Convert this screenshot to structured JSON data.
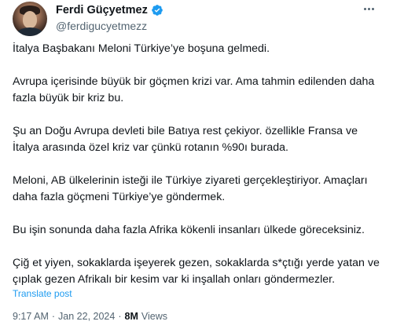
{
  "author": {
    "display_name": "Ferdi Güçyetmez",
    "handle": "@ferdigucyetmezz",
    "verified_icon": "verified-badge-icon",
    "verified_color": "#1d9bf0"
  },
  "more_icon": "more-options-icon",
  "tweet": {
    "paragraphs": [
      "İtalya Başbakanı Meloni Türkiye’ye boşuna gelmedi.",
      "Avrupa içerisinde büyük bir göçmen krizi var. Ama tahmin edilenden daha fazla büyük bir kriz bu.",
      "Şu an Doğu Avrupa devleti bile Batıya rest çekiyor. özellikle Fransa ve İtalya arasında özel kriz var çünkü rotanın %90ı burada.",
      "Meloni, AB ülkelerinin isteği ile Türkiye ziyareti gerçekleştiriyor. Amaçları daha fazla göçmeni Türkiye’ye göndermek.",
      "Bu işin sonunda daha fazla Afrika kökenli insanları ülkede göreceksiniz.",
      "Çiğ et yiyen, sokaklarda işeyerek gezen, sokaklarda s*çtığı yerde yatan ve çıplak gezen Afrikalı bir kesim var ki inşallah onları göndermezler."
    ],
    "translate_label": "Translate post",
    "time": "9:17 AM",
    "separator": "·",
    "date": "Jan 22, 2024",
    "views_count": "8M",
    "views_label": "Views"
  },
  "colors": {
    "text": "#0f1419",
    "secondary": "#536471",
    "link": "#1d9bf0"
  }
}
